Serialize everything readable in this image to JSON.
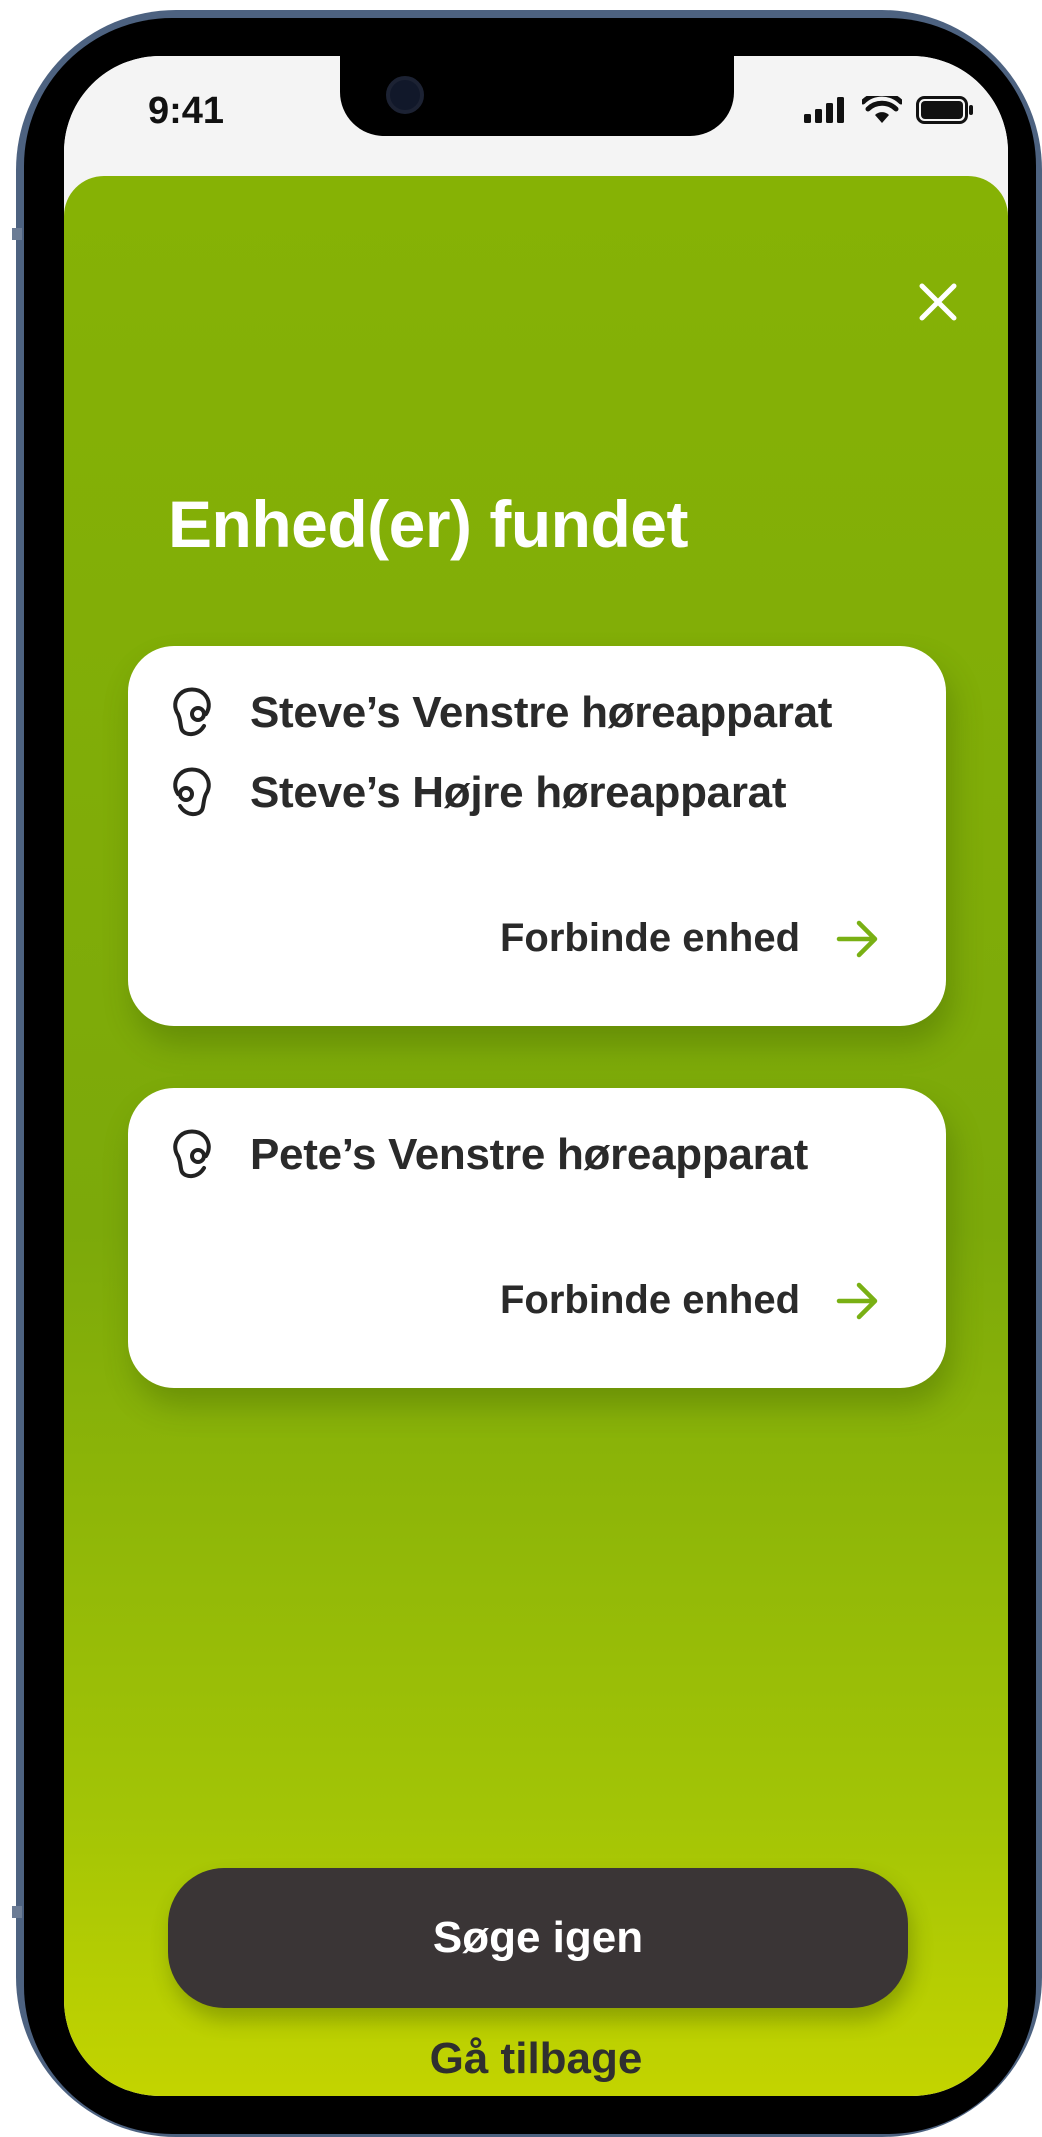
{
  "status_bar": {
    "time": "9:41"
  },
  "header": {
    "title": "Enhed(er) fundet",
    "close_icon": "close-icon"
  },
  "cards": [
    {
      "devices": [
        {
          "name": "Steve’s Venstre høreapparat",
          "icon": "left-ear-icon"
        },
        {
          "name": "Steve’s Højre høreapparat",
          "icon": "right-ear-icon"
        }
      ],
      "action_label": "Forbinde enhed",
      "action_icon": "arrow-right-icon"
    },
    {
      "devices": [
        {
          "name": "Pete’s Venstre høreapparat",
          "icon": "left-ear-icon"
        }
      ],
      "action_label": "Forbinde enhed",
      "action_icon": "arrow-right-icon"
    }
  ],
  "footer": {
    "search_again_label": "Søge igen",
    "go_back_label": "Gå tilbage"
  },
  "colors": {
    "accent_green": "#84b005",
    "accent_lime": "#c3d400",
    "arrow_green": "#79b014",
    "button_dark": "#3a3536",
    "card_white": "#ffffff"
  }
}
